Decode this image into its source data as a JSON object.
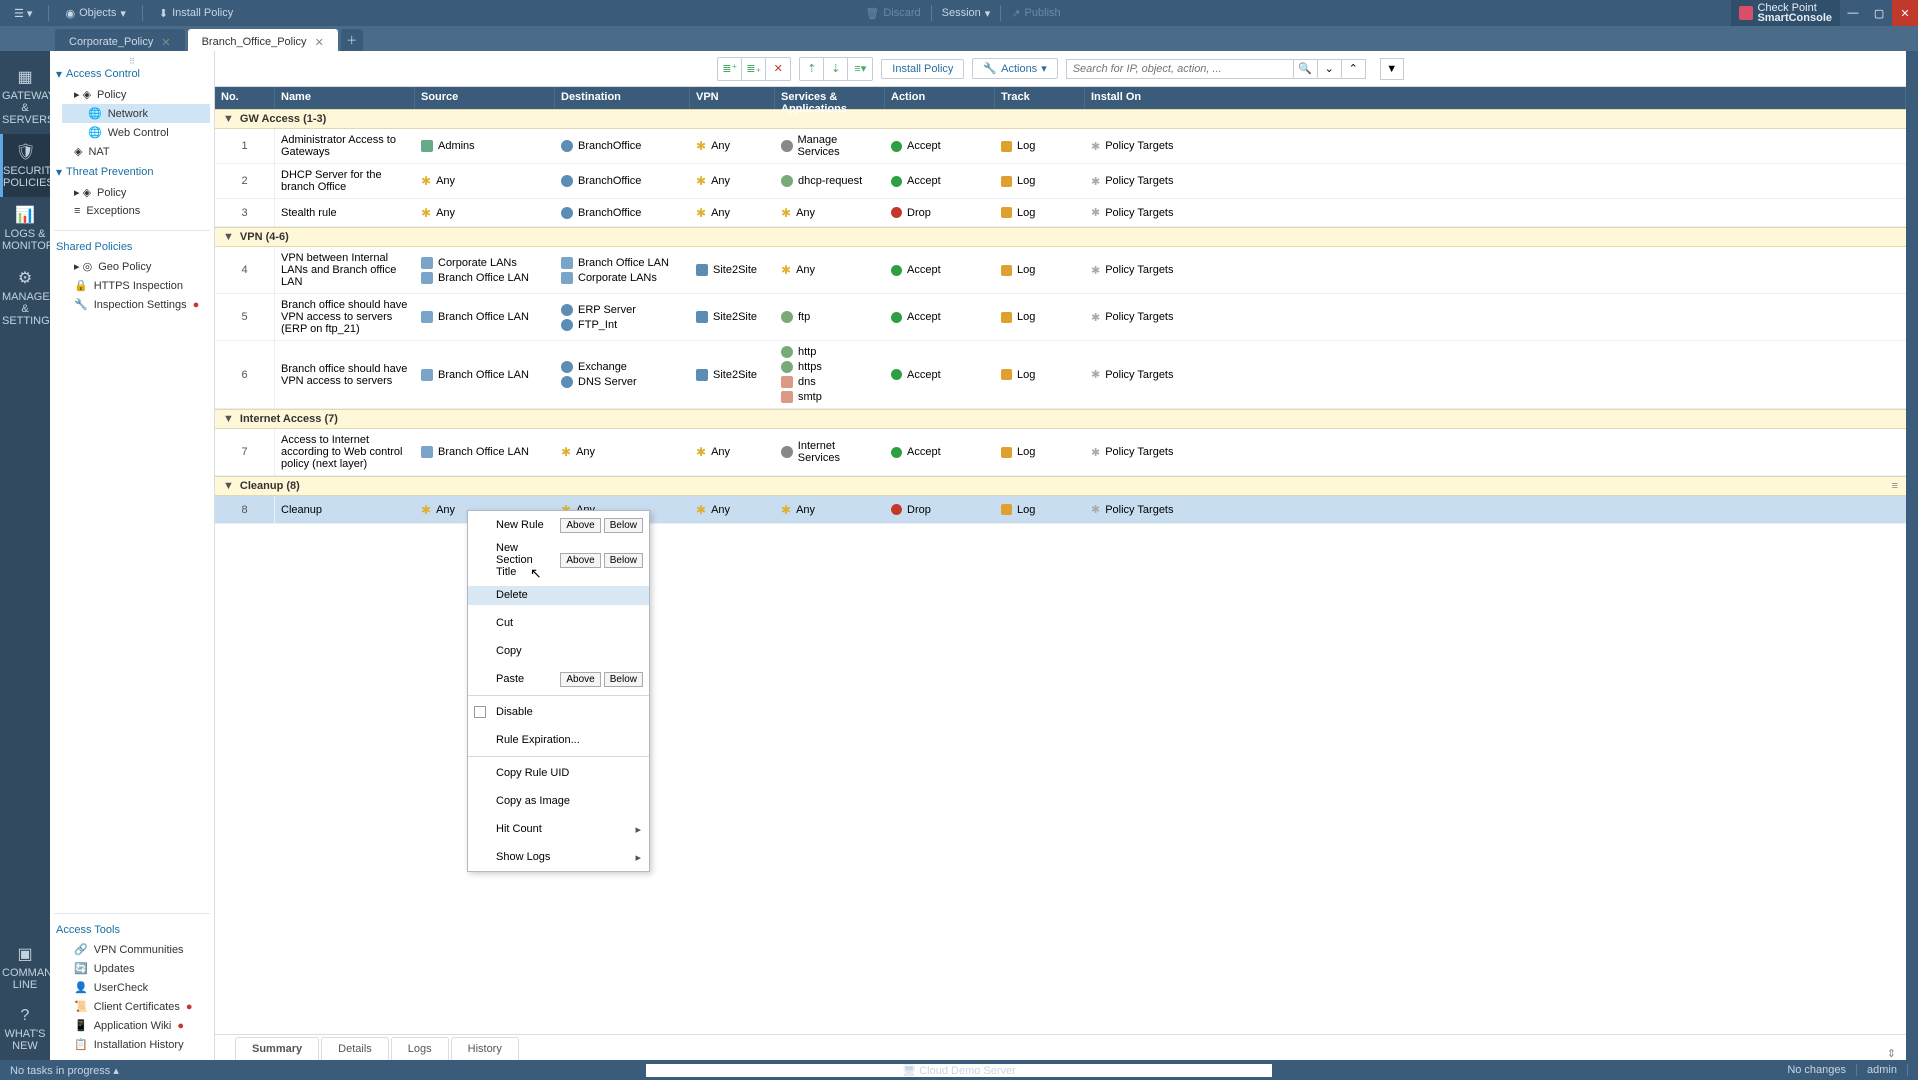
{
  "titlebar": {
    "menu_icon": "menu-icon",
    "objects": "Objects",
    "install_policy": "Install Policy",
    "discard": "Discard",
    "session": "Session",
    "publish": "Publish",
    "brand1": "Check Point",
    "brand2": "SmartConsole"
  },
  "tabs": {
    "t1": "Corporate_Policy",
    "t2": "Branch_Office_Policy"
  },
  "iconrail": {
    "gateways": "GATEWAYS & SERVERS",
    "security": "SECURITY POLICIES",
    "logs": "LOGS & MONITOR",
    "manage": "MANAGE & SETTINGS",
    "cmd": "COMMAND LINE",
    "whats": "WHAT'S NEW"
  },
  "leftnav": {
    "access_control": "Access Control",
    "policy": "Policy",
    "network": "Network",
    "web_control": "Web Control",
    "nat": "NAT",
    "threat_prevention": "Threat Prevention",
    "policy2": "Policy",
    "exceptions": "Exceptions",
    "shared_policies": "Shared Policies",
    "geo_policy": "Geo Policy",
    "https_inspection": "HTTPS Inspection",
    "inspection_settings": "Inspection Settings",
    "access_tools": "Access Tools",
    "vpn_communities": "VPN Communities",
    "updates": "Updates",
    "usercheck": "UserCheck",
    "client_certs": "Client Certificates",
    "app_wiki": "Application Wiki",
    "installation_history": "Installation History"
  },
  "toolbar2": {
    "install": "Install Policy",
    "actions": "Actions",
    "search_placeholder": "Search for IP, object, action, ..."
  },
  "columns": {
    "no": "No.",
    "name": "Name",
    "source": "Source",
    "destination": "Destination",
    "vpn": "VPN",
    "services": "Services & Applications",
    "action": "Action",
    "track": "Track",
    "install_on": "Install On"
  },
  "sections": {
    "gw_access": "GW Access  (1-3)",
    "vpn": "VPN  (4-6)",
    "internet": "Internet Access  (7)",
    "cleanup": "Cleanup  (8)"
  },
  "rows": {
    "r1": {
      "no": "1",
      "name": "Administrator Access to Gateways",
      "src": "Admins",
      "dst": "BranchOffice",
      "vpn": "Any",
      "svc": "Manage Services",
      "act": "Accept",
      "trk": "Log",
      "inst": "Policy Targets"
    },
    "r2": {
      "no": "2",
      "name": "DHCP Server for the branch Office",
      "src": "Any",
      "dst": "BranchOffice",
      "vpn": "Any",
      "svc": "dhcp-request",
      "act": "Accept",
      "trk": "Log",
      "inst": "Policy Targets"
    },
    "r3": {
      "no": "3",
      "name": "Stealth rule",
      "src": "Any",
      "dst": "BranchOffice",
      "vpn": "Any",
      "svc": "Any",
      "act": "Drop",
      "trk": "Log",
      "inst": "Policy Targets"
    },
    "r4": {
      "no": "4",
      "name": "VPN between Internal LANs and Branch office LAN",
      "src1": "Corporate LANs",
      "src2": "Branch Office LAN",
      "dst1": "Branch Office LAN",
      "dst2": "Corporate LANs",
      "vpn": "Site2Site",
      "svc": "Any",
      "act": "Accept",
      "trk": "Log",
      "inst": "Policy Targets"
    },
    "r5": {
      "no": "5",
      "name": "Branch office should have VPN access to servers (ERP on ftp_21)",
      "src": "Branch Office LAN",
      "dst1": "ERP Server",
      "dst2": "FTP_Int",
      "vpn": "Site2Site",
      "svc": "ftp",
      "act": "Accept",
      "trk": "Log",
      "inst": "Policy Targets"
    },
    "r6": {
      "no": "6",
      "name": "Branch office should have VPN access to servers",
      "src": "Branch Office LAN",
      "dst1": "Exchange",
      "dst2": "DNS Server",
      "vpn": "Site2Site",
      "svc1": "http",
      "svc2": "https",
      "svc3": "dns",
      "svc4": "smtp",
      "act": "Accept",
      "trk": "Log",
      "inst": "Policy Targets"
    },
    "r7": {
      "no": "7",
      "name": "Access to Internet according to Web control policy (next layer)",
      "src": "Branch Office LAN",
      "dst": "Any",
      "vpn": "Any",
      "svc": "Internet Services",
      "act": "Accept",
      "trk": "Log",
      "inst": "Policy Targets"
    },
    "r8": {
      "no": "8",
      "name": "Cleanup",
      "src": "Any",
      "dst": "Any",
      "vpn": "Any",
      "svc": "Any",
      "act": "Drop",
      "trk": "Log",
      "inst": "Policy Targets"
    }
  },
  "ctxmenu": {
    "new_rule": "New Rule",
    "new_section": "New Section Title",
    "delete": "Delete",
    "cut": "Cut",
    "copy": "Copy",
    "paste": "Paste",
    "disable": "Disable",
    "rule_exp": "Rule Expiration...",
    "copy_uid": "Copy Rule UID",
    "copy_img": "Copy as Image",
    "hit_count": "Hit Count",
    "show_logs": "Show Logs",
    "above": "Above",
    "below": "Below"
  },
  "bottomtabs": {
    "summary": "Summary",
    "details": "Details",
    "logs": "Logs",
    "history": "History"
  },
  "statusbar": {
    "no_tasks": "No tasks in progress",
    "server": "Cloud Demo Server",
    "no_changes": "No changes",
    "user": "admin"
  }
}
